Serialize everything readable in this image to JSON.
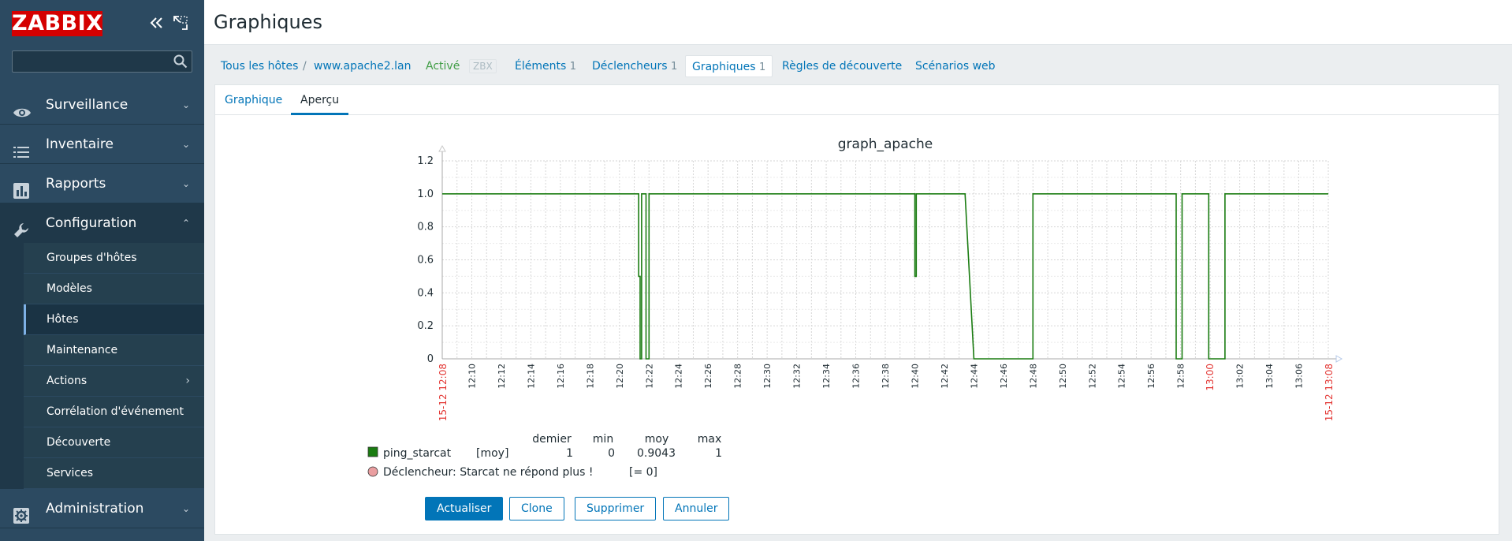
{
  "app": {
    "logo": "ZABBIX",
    "colors": {
      "sidebar": "#2c4a61",
      "logo": "#d40000",
      "link": "#0275b8",
      "active_green": "#429e47",
      "series": "#1a7c11"
    }
  },
  "sidebar": {
    "icons": [
      "collapse-icon",
      "kiosk-mode-icon"
    ],
    "search": {
      "value": "",
      "placeholder": ""
    },
    "menu": [
      {
        "label": "Surveillance",
        "icon": "eye-icon"
      },
      {
        "label": "Inventaire",
        "icon": "list-icon"
      },
      {
        "label": "Rapports",
        "icon": "bar-chart-icon"
      },
      {
        "label": "Configuration",
        "icon": "wrench-icon"
      },
      {
        "label": "Administration",
        "icon": "gear-icon"
      }
    ],
    "config_submenu": [
      {
        "label": "Groupes d'hôtes"
      },
      {
        "label": "Modèles"
      },
      {
        "label": "Hôtes"
      },
      {
        "label": "Maintenance"
      },
      {
        "label": "Actions"
      },
      {
        "label": "Corrélation d'événement"
      },
      {
        "label": "Découverte"
      },
      {
        "label": "Services"
      }
    ]
  },
  "header": {
    "title": "Graphiques"
  },
  "breadcrumb": {
    "all_hosts": "Tous les hôtes",
    "separator": "/",
    "host": "www.apache2.lan",
    "status": "Activé",
    "zbx": "ZBX",
    "items": {
      "label": "Éléments",
      "count": "1"
    },
    "triggers": {
      "label": "Déclencheurs",
      "count": "1"
    },
    "graphs": {
      "label": "Graphiques",
      "count": "1"
    },
    "discovery": "Règles de découverte",
    "web": "Scénarios web"
  },
  "tabs": {
    "graph": "Graphique",
    "preview": "Aperçu"
  },
  "chart_data": {
    "type": "line",
    "title": "graph_apache",
    "ylim": [
      0,
      1.2
    ],
    "y_ticks": [
      "1.2",
      "1.0",
      "0.8",
      "0.6",
      "0.4",
      "0.2",
      "0"
    ],
    "x_ticks": [
      "12:10",
      "12:12",
      "12:14",
      "12:16",
      "12:18",
      "12:20",
      "12:22",
      "12:24",
      "12:26",
      "12:28",
      "12:30",
      "12:32",
      "12:34",
      "12:36",
      "12:38",
      "12:40",
      "12:42",
      "12:44",
      "12:46",
      "12:48",
      "12:50",
      "12:52",
      "12:54",
      "12:56",
      "12:58",
      "13:00",
      "13:02",
      "13:04",
      "13:06"
    ],
    "x_start_label": "15-12 12:08",
    "x_end_label": "15-12 13:08",
    "x_highlight": "13:00",
    "grid": true,
    "series": [
      {
        "name": "ping_starcat",
        "color": "#1a7c11",
        "x": [
          "12:08",
          "12:21.3",
          "12:21.3",
          "12:21.4",
          "12:21.4",
          "12:21.5",
          "12:21.5",
          "12:21.8",
          "12:21.8",
          "12:22.0",
          "12:22.0",
          "12:40.0",
          "12:40.0",
          "12:40.1",
          "12:40.1",
          "12:43.4",
          "12:44.0",
          "12:48.0",
          "12:48.0",
          "12:57.7",
          "12:57.7",
          "12:58.1",
          "12:58.1",
          "12:59.9",
          "12:59.9",
          "13:01.0",
          "13:01.0",
          "13:08"
        ],
        "values": [
          1,
          1,
          0.5,
          0.5,
          0,
          0,
          1,
          1,
          0,
          0,
          1,
          1,
          0.5,
          0.5,
          1,
          1,
          0,
          0,
          1,
          1,
          0,
          0,
          1,
          1,
          0,
          0,
          1,
          1
        ]
      }
    ],
    "legend_headers": [
      "demier",
      "min",
      "moy",
      "max"
    ],
    "legend": [
      {
        "name": "ping_starcat",
        "func": "[moy]",
        "demier": "1",
        "min": "0",
        "moy": "0.9043",
        "max": "1",
        "color": "#1a7c11"
      }
    ],
    "trigger": {
      "label": "Déclencheur: Starcat ne répond plus !",
      "condition": "[= 0]",
      "color": "#ea9ea0"
    }
  },
  "buttons": {
    "update": "Actualiser",
    "clone": "Clone",
    "delete": "Supprimer",
    "cancel": "Annuler"
  }
}
